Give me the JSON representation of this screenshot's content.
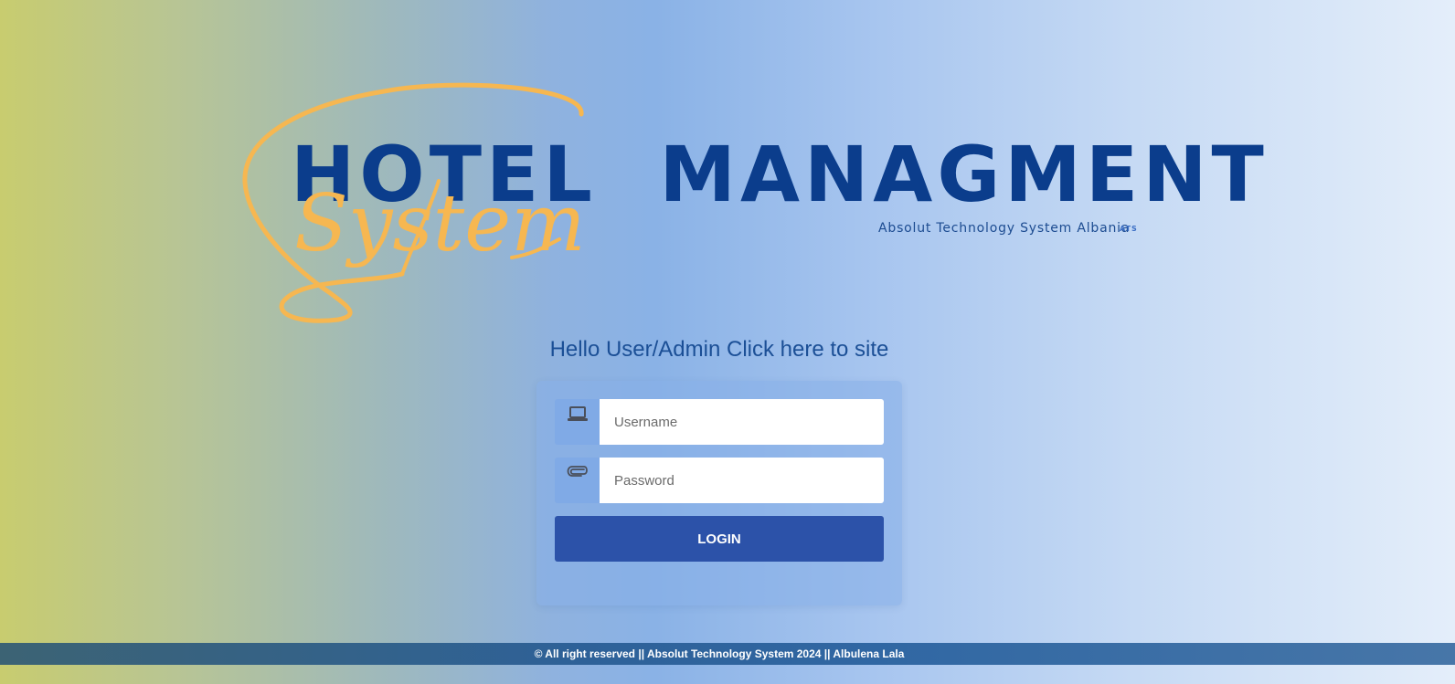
{
  "logo": {
    "title": "HOTEL  MANAGMENT",
    "script_word": "System",
    "tagline": "Absolut Technology System Albania",
    "badge": "ATS",
    "title_color": "#0b3d8c",
    "script_color": "#f6b751"
  },
  "greeting": {
    "text": "Hello User/Admin Click here to site"
  },
  "login_form": {
    "username": {
      "placeholder": "Username",
      "value": "",
      "icon": "laptop-icon"
    },
    "password": {
      "placeholder": "Password",
      "value": "",
      "icon": "paperclip-icon"
    },
    "submit_label": "LOGIN",
    "button_color": "#2c52a9"
  },
  "footer": {
    "text": "© All right reserved || Absolut Technology System 2024 || Albulena Lala"
  }
}
